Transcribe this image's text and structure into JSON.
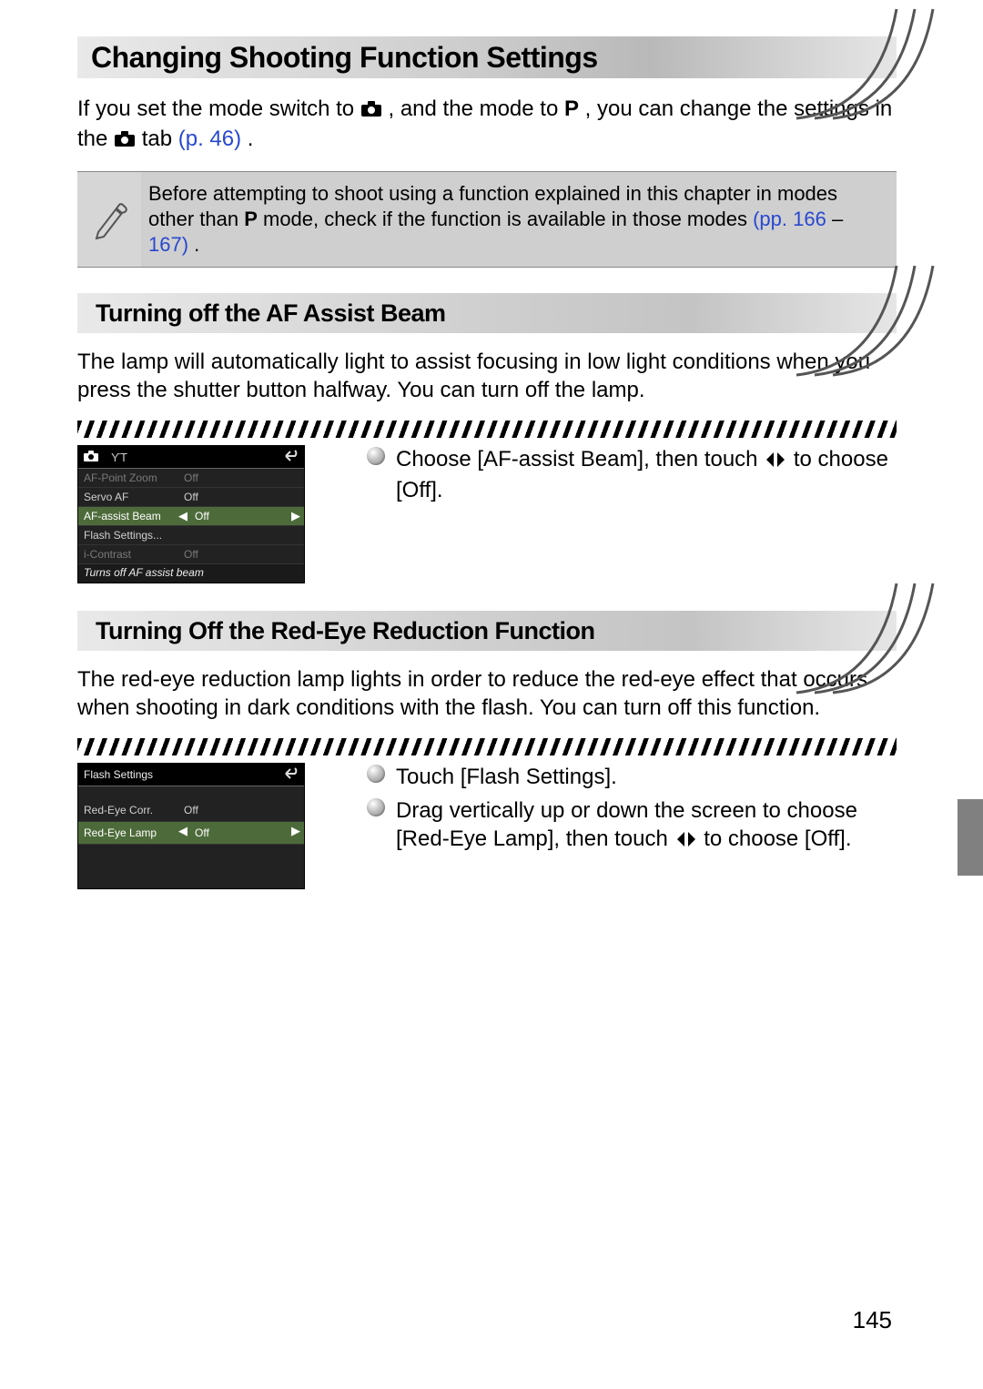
{
  "main_heading": "Changing Shooting Function Settings",
  "intro": {
    "part1": "If you set the mode switch to ",
    "part2": ", and the mode to ",
    "p_letter": "P",
    "part3": ", you can change the settings in the ",
    "part4": " tab ",
    "pref": "(p. 46)",
    "end": "."
  },
  "hint": {
    "part1": "Before attempting to shoot using a function explained in this chapter in modes other than ",
    "p_letter": "P",
    "part2": " mode, check if the function is available in those modes ",
    "pref1": "(pp. 166",
    "dash": " – ",
    "pref2": "167)",
    "end": "."
  },
  "section1": {
    "heading": "Turning off the AF Assist Beam",
    "body": "The lamp will automatically light to assist focusing in low light conditions when you press the shutter button halfway. You can turn off the lamp.",
    "menu": {
      "rows": [
        {
          "label": "AF-Point Zoom",
          "val": "Off",
          "muted": true
        },
        {
          "label": "Servo AF",
          "val": "Off"
        },
        {
          "label": "AF-assist Beam",
          "val": "Off",
          "selected": true
        },
        {
          "label": "Flash Settings...",
          "val": ""
        },
        {
          "label": "i-Contrast",
          "val": "Off",
          "muted": true
        }
      ],
      "footer": "Turns off AF assist beam"
    },
    "instructions": [
      {
        "pre": "Choose [AF-assist Beam], then touch ",
        "post": " to choose [Off]."
      }
    ]
  },
  "section2": {
    "heading": "Turning Off the Red-Eye Reduction Function",
    "body": "The red-eye reduction lamp lights in order to reduce the red-eye effect that occurs when shooting in dark conditions with the flash. You can turn off this function.",
    "menu": {
      "title": "Flash Settings",
      "rows": [
        {
          "label": "Red-Eye Corr.",
          "val": "Off"
        },
        {
          "label": "Red-Eye Lamp",
          "val": "Off",
          "selected": true
        }
      ]
    },
    "instructions": [
      {
        "pre": "Touch [Flash Settings]."
      },
      {
        "pre": "Drag vertically up or down the screen to choose [Red-Eye Lamp], then touch ",
        "arrows": true,
        "post": " to choose [Off]."
      }
    ]
  },
  "page_number": "145"
}
